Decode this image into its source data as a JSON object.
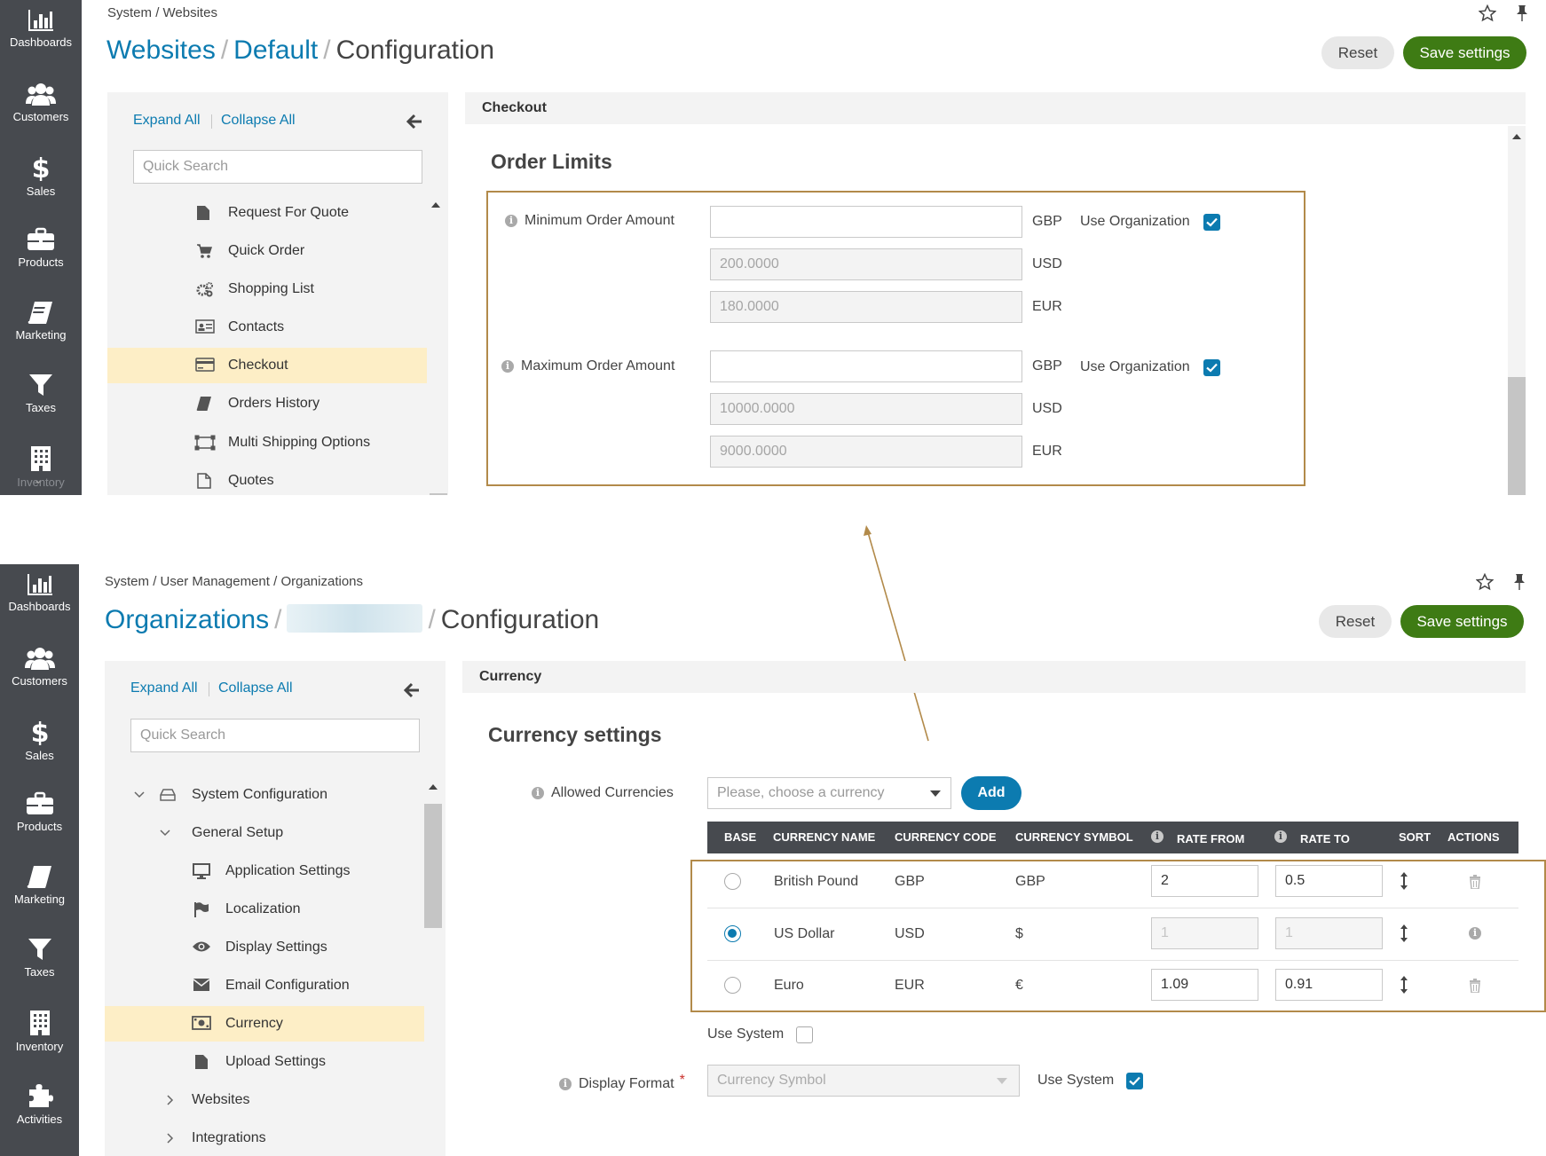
{
  "nav": {
    "top": [
      {
        "label": "Dashboards",
        "icon": "bar-chart-icon"
      },
      {
        "label": "Customers",
        "icon": "users-icon"
      },
      {
        "label": "Sales",
        "icon": "dollar-icon"
      },
      {
        "label": "Products",
        "icon": "briefcase-icon"
      },
      {
        "label": "Marketing",
        "icon": "book-icon"
      },
      {
        "label": "Taxes",
        "icon": "filter-icon"
      },
      {
        "label": "Inventory",
        "icon": "building-icon"
      }
    ],
    "bottom": [
      {
        "label": "Dashboards",
        "icon": "bar-chart-icon"
      },
      {
        "label": "Customers",
        "icon": "users-icon"
      },
      {
        "label": "Sales",
        "icon": "dollar-icon"
      },
      {
        "label": "Products",
        "icon": "briefcase-icon"
      },
      {
        "label": "Marketing",
        "icon": "book-icon"
      },
      {
        "label": "Taxes",
        "icon": "filter-icon"
      },
      {
        "label": "Inventory",
        "icon": "building-icon"
      },
      {
        "label": "Activities",
        "icon": "puzzle-icon"
      }
    ]
  },
  "top": {
    "breadcrumb": {
      "a": "System",
      "sep": "/",
      "b": "Websites"
    },
    "title": {
      "part1": "Websites",
      "sep": "/",
      "part2": "Default",
      "part3": "Configuration"
    },
    "buttons": {
      "reset": "Reset",
      "save": "Save settings"
    },
    "tree": {
      "expand": "Expand All",
      "collapse": "Collapse All",
      "search_placeholder": "Quick Search",
      "items": [
        "Request For Quote",
        "Quick Order",
        "Shopping List",
        "Contacts",
        "Checkout",
        "Orders History",
        "Multi Shipping Options",
        "Quotes"
      ]
    },
    "section": "Checkout",
    "group_title": "Order Limits",
    "min": {
      "label": "Minimum Order Amount",
      "rows": [
        {
          "value": "",
          "currency": "GBP"
        },
        {
          "value": "200.0000",
          "currency": "USD"
        },
        {
          "value": "180.0000",
          "currency": "EUR"
        }
      ],
      "use_label": "Use Organization"
    },
    "max": {
      "label": "Maximum Order Amount",
      "rows": [
        {
          "value": "",
          "currency": "GBP"
        },
        {
          "value": "10000.0000",
          "currency": "USD"
        },
        {
          "value": "9000.0000",
          "currency": "EUR"
        }
      ],
      "use_label": "Use Organization"
    }
  },
  "bottom": {
    "breadcrumb": {
      "a": "System",
      "sep1": "/",
      "b": "User Management",
      "sep2": "/",
      "c": "Organizations"
    },
    "title": {
      "part1": "Organizations",
      "sep": "/",
      "part3": "Configuration"
    },
    "buttons": {
      "reset": "Reset",
      "save": "Save settings"
    },
    "tree": {
      "expand": "Expand All",
      "collapse": "Collapse All",
      "search_placeholder": "Quick Search",
      "items": [
        "System Configuration",
        "General Setup",
        "Application Settings",
        "Localization",
        "Display Settings",
        "Email Configuration",
        "Currency",
        "Upload Settings",
        "Websites",
        "Integrations"
      ]
    },
    "section": "Currency",
    "group_title": "Currency settings",
    "allowed_label": "Allowed Currencies",
    "select_placeholder": "Please, choose a currency",
    "add": "Add",
    "table": {
      "headers": [
        "BASE",
        "CURRENCY NAME",
        "CURRENCY CODE",
        "CURRENCY SYMBOL",
        "RATE FROM",
        "RATE TO",
        "SORT",
        "ACTIONS"
      ],
      "rows": [
        {
          "name": "British Pound",
          "code": "GBP",
          "symbol": "GBP",
          "rate_from": "2",
          "rate_to": "0.5",
          "base": false
        },
        {
          "name": "US Dollar",
          "code": "USD",
          "symbol": "$",
          "rate_from": "1",
          "rate_to": "1",
          "base": true
        },
        {
          "name": "Euro",
          "code": "EUR",
          "symbol": "€",
          "rate_from": "1.09",
          "rate_to": "0.91",
          "base": false
        }
      ]
    },
    "use_system": "Use System",
    "display_format_label": "Display Format",
    "required_mark": "*",
    "display_format_value": "Currency Symbol",
    "use_system_2": "Use System"
  },
  "colors": {
    "link": "#0c7bb0",
    "save": "#3e7b14",
    "nav_bg": "#474a4f",
    "selected": "#fdeec6",
    "highlight_border": "#b28a4a"
  }
}
